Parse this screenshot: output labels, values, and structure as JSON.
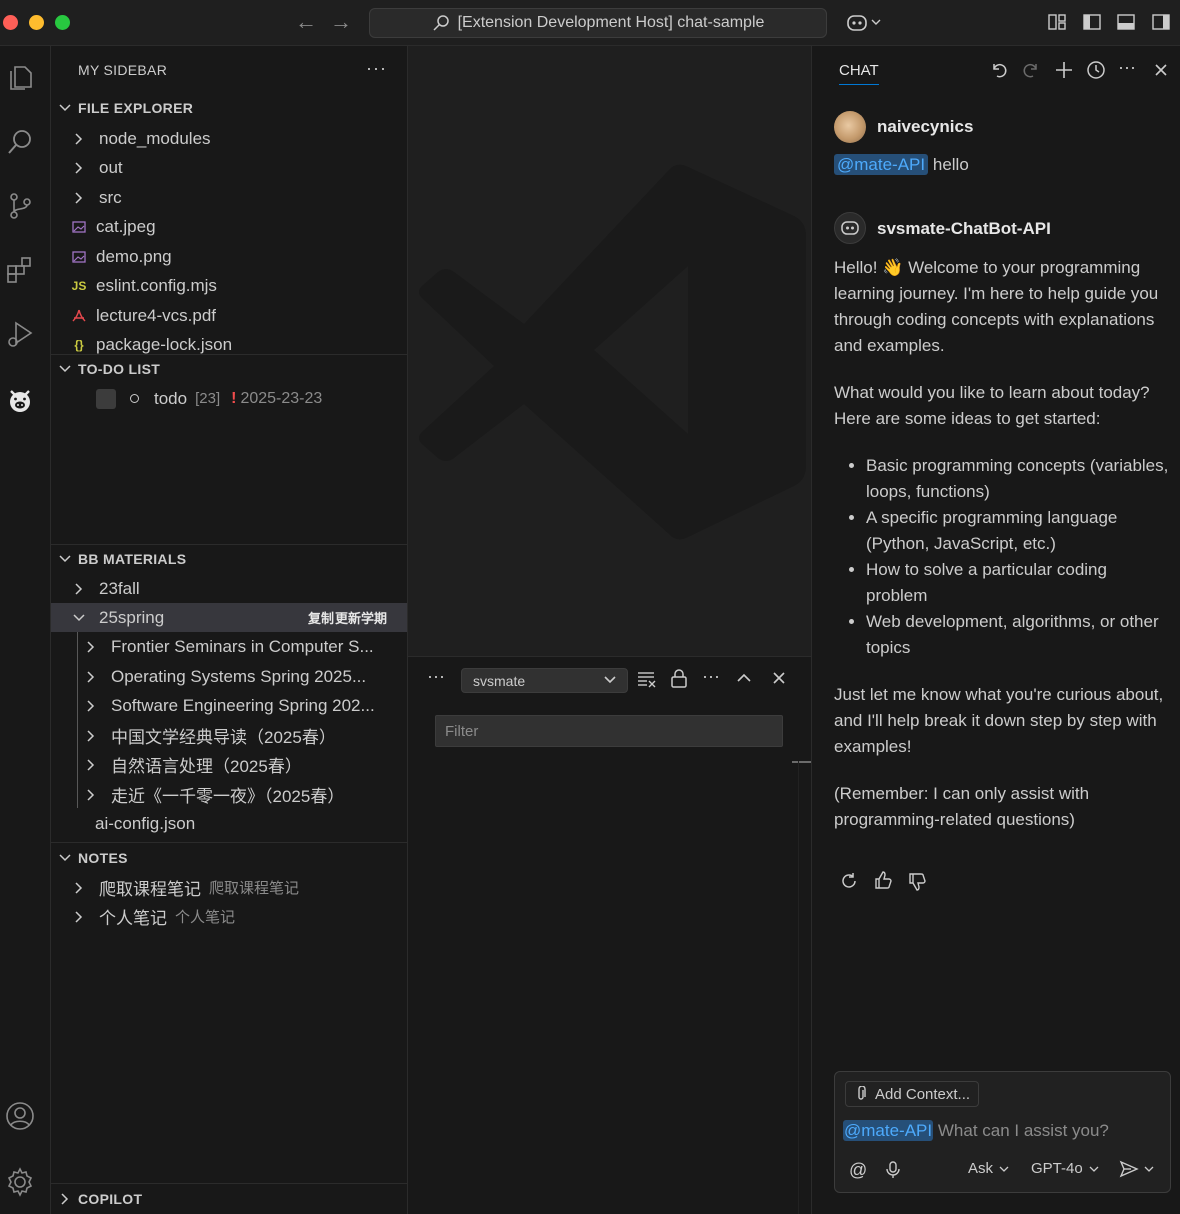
{
  "titlebar": {
    "command_center": "[Extension Development Host] chat-sample"
  },
  "sidebar": {
    "title": "MY SIDEBAR",
    "more": "···",
    "file_explorer": {
      "header": "FILE EXPLORER",
      "items": [
        {
          "label": "node_modules",
          "kind": "folder"
        },
        {
          "label": "out",
          "kind": "folder"
        },
        {
          "label": "src",
          "kind": "folder"
        },
        {
          "label": "cat.jpeg",
          "kind": "image"
        },
        {
          "label": "demo.png",
          "kind": "image"
        },
        {
          "label": "eslint.config.mjs",
          "kind": "js",
          "icon_text": "JS"
        },
        {
          "label": "lecture4-vcs.pdf",
          "kind": "pdf"
        },
        {
          "label": "package-lock.json",
          "kind": "json",
          "icon_text": "{}"
        }
      ]
    },
    "todo": {
      "header": "TO-DO LIST",
      "item": {
        "label": "todo",
        "count": "[23]",
        "flag": "!",
        "date": "2025-23-23"
      }
    },
    "bb": {
      "header": "BB MATERIALS",
      "fall": "23fall",
      "spring": "25spring",
      "spring_actions": [
        "复制",
        "更新学期"
      ],
      "courses": [
        "Frontier Seminars in Computer S...",
        "Operating Systems Spring 2025...",
        "Software Engineering Spring 202...",
        "中国文学经典导读（2025春）",
        "自然语言处理（2025春）",
        "走近《一千零一夜》（2025春）"
      ],
      "config": "ai-config.json"
    },
    "notes": {
      "header": "NOTES",
      "items": [
        {
          "label": "爬取课程笔记",
          "desc": "爬取课程笔记"
        },
        {
          "label": "个人笔记",
          "desc": "个人笔记"
        }
      ]
    },
    "copilot": {
      "header": "COPILOT"
    }
  },
  "panel": {
    "select_value": "svsmate",
    "filter_placeholder": "Filter",
    "more": "···"
  },
  "chat": {
    "tab": "CHAT",
    "user": {
      "name": "naivecynics",
      "mention": "@mate-API",
      "message": "hello"
    },
    "bot": {
      "name": "svsmate-ChatBot-API",
      "intro": "Hello! 👋 Welcome to your programming learning journey. I'm here to help guide you through coding concepts with explanations and examples.",
      "question": "What would you like to learn about today? Here are some ideas to get started:",
      "ideas": [
        "Basic programming concepts (variables, loops, functions)",
        "A specific programming language (Python, JavaScript, etc.)",
        "How to solve a particular coding problem",
        "Web development, algorithms, or other topics"
      ],
      "closing": "Just let me know what you're curious about, and I'll help break it down step by step with examples!",
      "reminder": "(Remember: I can only assist with programming-related questions)"
    },
    "input": {
      "add_context": "Add Context...",
      "mention": "@mate-API",
      "placeholder": "What can I assist you?",
      "mode": "Ask",
      "model": "GPT-4o"
    }
  },
  "colors": {
    "accent": "#0078d4",
    "mention": "#4daafc",
    "danger": "#f14c4c",
    "js": "#cbcb41",
    "pdf": "#e5484d"
  }
}
